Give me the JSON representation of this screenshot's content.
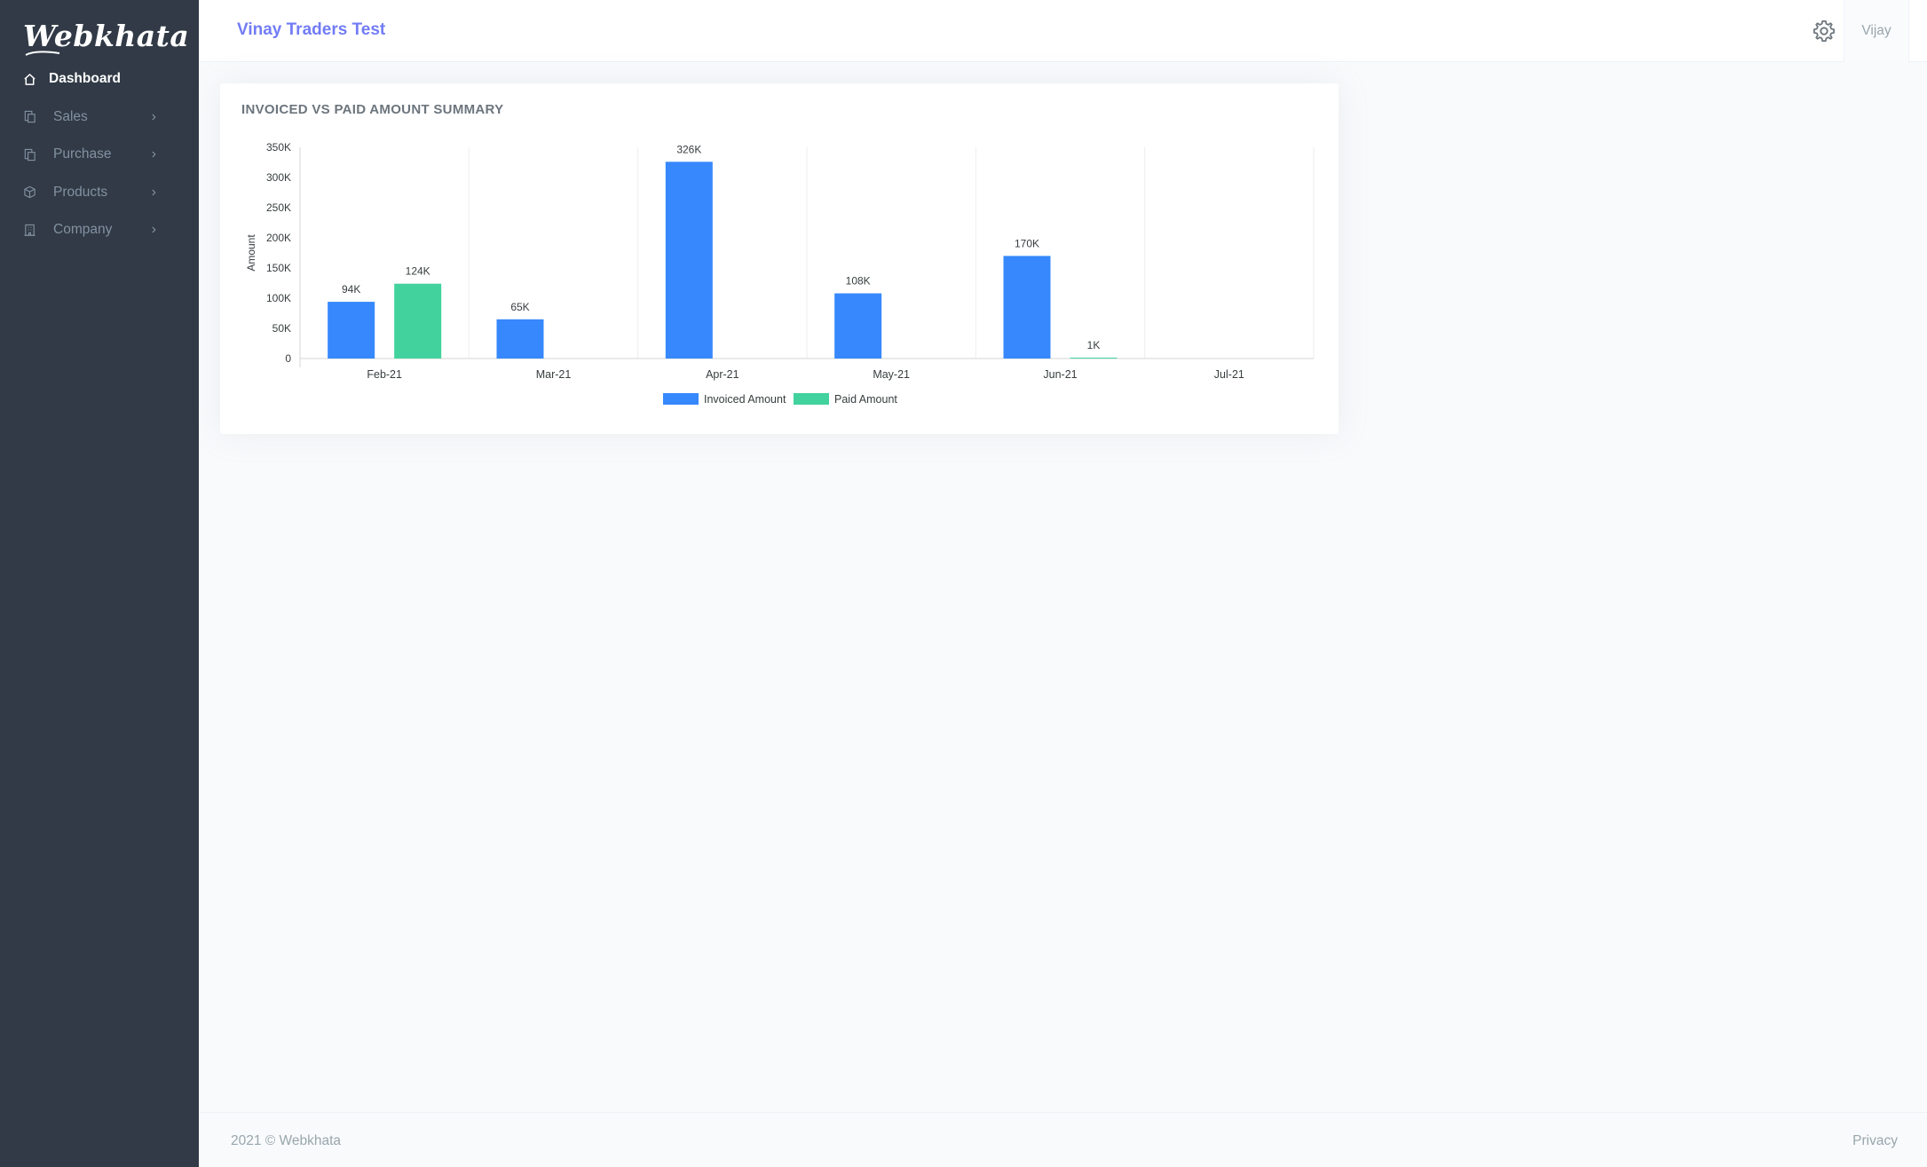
{
  "app": {
    "logo_text": "Webkhata",
    "company_name": "Vinay Traders Test",
    "user_name": "Vijay"
  },
  "sidebar": {
    "items": [
      {
        "label": "Dashboard",
        "icon": "home-icon",
        "active": true
      },
      {
        "label": "Sales",
        "icon": "sales-doc-icon",
        "has_arrow": true
      },
      {
        "label": "Purchase",
        "icon": "purchase-doc-icon",
        "has_arrow": true
      },
      {
        "label": "Products",
        "icon": "box-icon",
        "has_arrow": true
      },
      {
        "label": "Company",
        "icon": "building-icon",
        "has_arrow": true
      }
    ],
    "arrow": "›"
  },
  "card": {
    "title": "INVOICED VS PAID AMOUNT SUMMARY"
  },
  "chart_data": {
    "type": "bar",
    "title": "INVOICED VS PAID AMOUNT SUMMARY",
    "xlabel": "",
    "ylabel": "Amount",
    "ylim": [
      0,
      350000
    ],
    "yticks": [
      "0",
      "50K",
      "100K",
      "150K",
      "200K",
      "250K",
      "300K",
      "350K"
    ],
    "categories": [
      "Feb-21",
      "Mar-21",
      "Apr-21",
      "May-21",
      "Jun-21",
      "Jul-21"
    ],
    "series": [
      {
        "name": "Invoiced Amount",
        "color": "#3688fc",
        "values": [
          94000,
          65000,
          326000,
          108000,
          170000,
          null
        ],
        "labels": [
          "94K",
          "65K",
          "326K",
          "108K",
          "170K",
          ""
        ]
      },
      {
        "name": "Paid Amount",
        "color": "#42d29d",
        "values": [
          124000,
          null,
          null,
          null,
          1000,
          null
        ],
        "labels": [
          "124K",
          "",
          "",
          "",
          "1K",
          ""
        ]
      }
    ],
    "grid": "vertical",
    "legend": "bottom-center"
  },
  "footer": {
    "copyright": "2021 © Webkhata",
    "privacy": "Privacy"
  },
  "colors": {
    "sidebar_bg": "#313a46",
    "accent": "#727cf5",
    "invoiced": "#3688fc",
    "paid": "#42d29d"
  }
}
